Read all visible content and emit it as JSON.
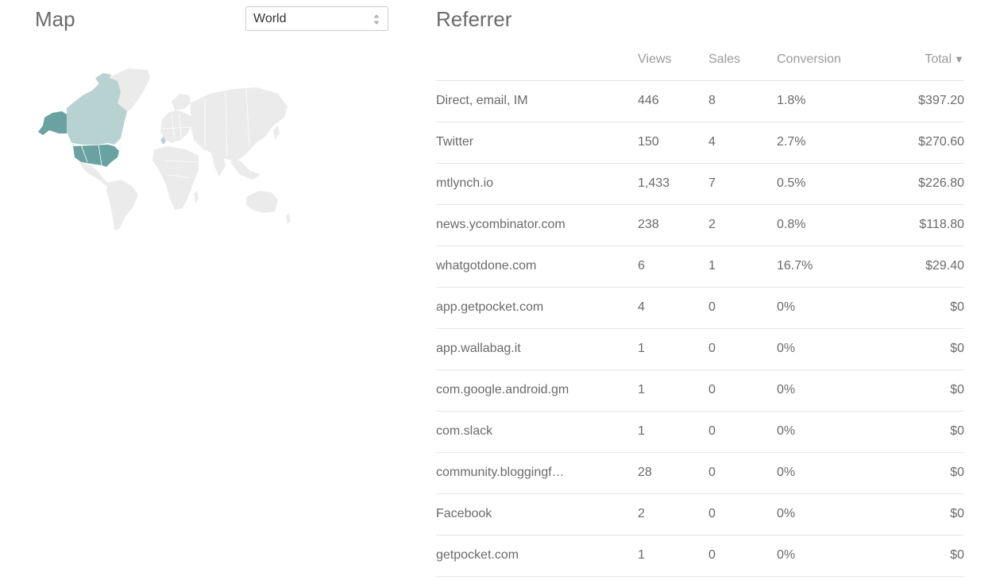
{
  "map": {
    "title": "Map",
    "region_select": {
      "selected": "World"
    },
    "colors": {
      "highlight": "#6aa2a2",
      "light": "#b8d2d2",
      "base": "#ebebeb"
    }
  },
  "referrer": {
    "title": "Referrer",
    "columns": {
      "referrer": "",
      "views": "Views",
      "sales": "Sales",
      "conversion": "Conversion",
      "total": "Total"
    },
    "sort_icon": "▼",
    "rows": [
      {
        "name": "Direct, email, IM",
        "views": "446",
        "sales": "8",
        "conversion": "1.8%",
        "total": "$397.20"
      },
      {
        "name": "Twitter",
        "views": "150",
        "sales": "4",
        "conversion": "2.7%",
        "total": "$270.60"
      },
      {
        "name": "mtlynch.io",
        "views": "1,433",
        "sales": "7",
        "conversion": "0.5%",
        "total": "$226.80"
      },
      {
        "name": "news.ycombinator.com",
        "views": "238",
        "sales": "2",
        "conversion": "0.8%",
        "total": "$118.80"
      },
      {
        "name": "whatgotdone.com",
        "views": "6",
        "sales": "1",
        "conversion": "16.7%",
        "total": "$29.40"
      },
      {
        "name": "app.getpocket.com",
        "views": "4",
        "sales": "0",
        "conversion": "0%",
        "total": "$0"
      },
      {
        "name": "app.wallabag.it",
        "views": "1",
        "sales": "0",
        "conversion": "0%",
        "total": "$0"
      },
      {
        "name": "com.google.android.gm",
        "views": "1",
        "sales": "0",
        "conversion": "0%",
        "total": "$0"
      },
      {
        "name": "com.slack",
        "views": "1",
        "sales": "0",
        "conversion": "0%",
        "total": "$0"
      },
      {
        "name": "community.bloggingf…",
        "views": "28",
        "sales": "0",
        "conversion": "0%",
        "total": "$0"
      },
      {
        "name": "Facebook",
        "views": "2",
        "sales": "0",
        "conversion": "0%",
        "total": "$0"
      },
      {
        "name": "getpocket.com",
        "views": "1",
        "sales": "0",
        "conversion": "0%",
        "total": "$0"
      }
    ]
  }
}
